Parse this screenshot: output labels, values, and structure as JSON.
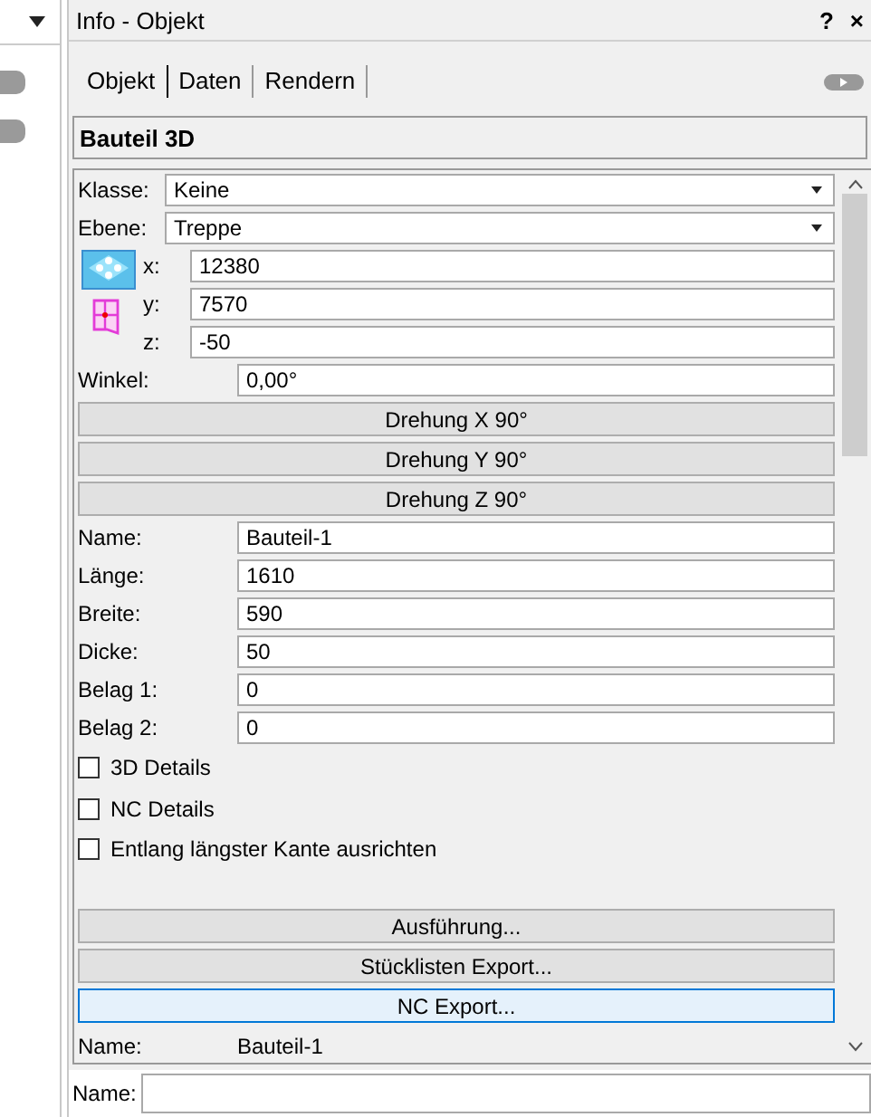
{
  "panel": {
    "title": "Info - Objekt",
    "help": "?",
    "close": "×"
  },
  "tabs": [
    {
      "label": "Objekt",
      "selected": true
    },
    {
      "label": "Daten",
      "selected": false
    },
    {
      "label": "Rendern",
      "selected": false
    }
  ],
  "object_type": "Bauteil 3D",
  "dropdowns": [
    {
      "label": "Klasse:",
      "value": "Keine"
    },
    {
      "label": "Ebene:",
      "value": "Treppe"
    }
  ],
  "coordinates": [
    {
      "label": "x:",
      "value": "12380"
    },
    {
      "label": "y:",
      "value": "7570"
    },
    {
      "label": "z:",
      "value": "-50"
    }
  ],
  "angle": {
    "label": "Winkel:",
    "value": "0,00°"
  },
  "rotate_buttons": [
    "Drehung X 90°",
    "Drehung Y 90°",
    "Drehung Z 90°"
  ],
  "fields": [
    {
      "label": "Name:",
      "value": "Bauteil-1"
    },
    {
      "label": "Länge:",
      "value": "1610"
    },
    {
      "label": "Breite:",
      "value": "590"
    },
    {
      "label": "Dicke:",
      "value": "50"
    },
    {
      "label": "Belag 1:",
      "value": "0"
    },
    {
      "label": "Belag 2:",
      "value": "0"
    }
  ],
  "checkboxes": [
    {
      "label": "3D Details",
      "checked": false
    },
    {
      "label": "NC Details",
      "checked": false
    },
    {
      "label": "Entlang längster Kante ausrichten",
      "checked": false
    }
  ],
  "action_buttons": [
    {
      "label": "Ausführung...",
      "selected": false
    },
    {
      "label": "Stücklisten Export...",
      "selected": false
    },
    {
      "label": "NC Export...",
      "selected": true
    }
  ],
  "name_readout": {
    "label": "Name:",
    "value": "Bauteil-1"
  },
  "name_field": {
    "label": "Name:"
  }
}
